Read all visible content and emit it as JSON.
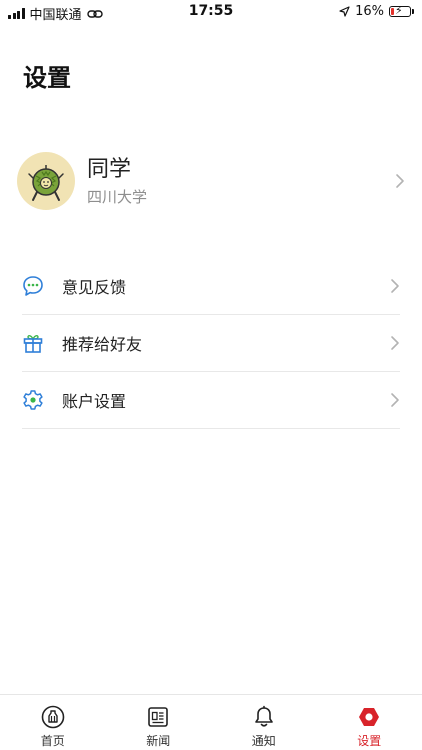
{
  "status_bar": {
    "carrier": "中国联通",
    "time": "17:55",
    "battery": "16%",
    "battery_level": 0.16
  },
  "page": {
    "title": "设置"
  },
  "profile": {
    "name": "同学",
    "school": "四川大学"
  },
  "menu": [
    {
      "label": "意见反馈",
      "icon": "chat-bubble-icon"
    },
    {
      "label": "推荐给好友",
      "icon": "gift-icon"
    },
    {
      "label": "账户设置",
      "icon": "gear-icon"
    }
  ],
  "tabs": [
    {
      "label": "首页",
      "icon": "home-icon"
    },
    {
      "label": "新闻",
      "icon": "news-icon"
    },
    {
      "label": "通知",
      "icon": "bell-icon"
    },
    {
      "label": "设置",
      "icon": "settings-icon",
      "active": true
    }
  ],
  "colors": {
    "accent": "#d8232a",
    "icon_blue": "#2f7fd8",
    "icon_green": "#3bb54a"
  }
}
